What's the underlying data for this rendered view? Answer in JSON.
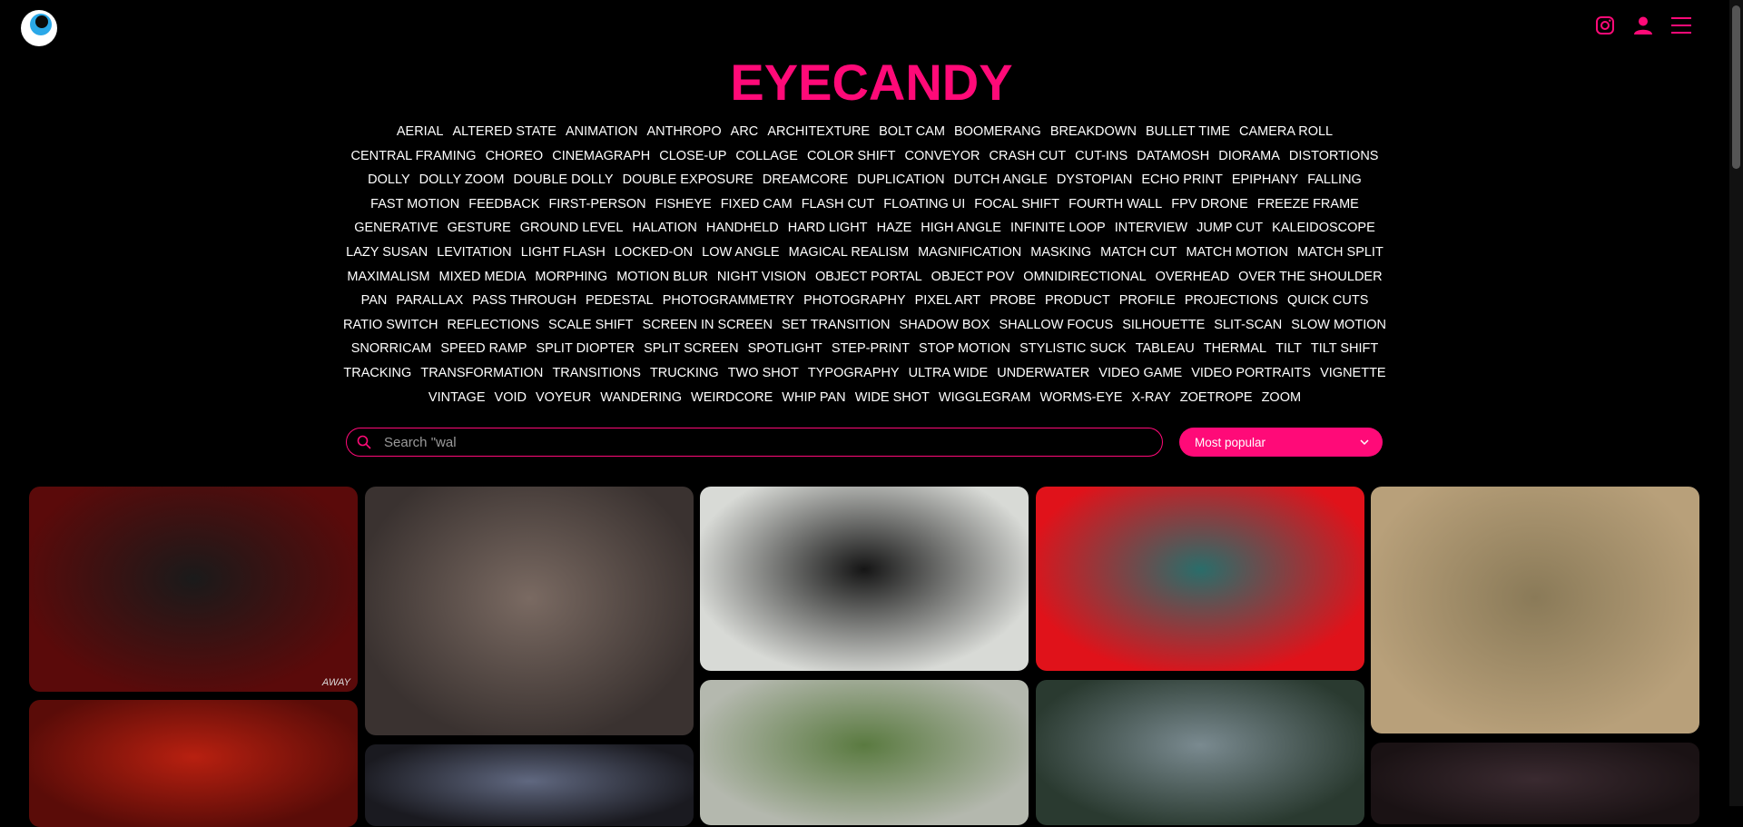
{
  "brand": {
    "title": "EYECANDY",
    "accent": "#ff0a78"
  },
  "header": {
    "logo_icon": "eye-logo-icon",
    "icons": [
      "instagram-icon",
      "user-icon",
      "hamburger-menu-icon"
    ]
  },
  "tags": [
    "AERIAL",
    "ALTERED STATE",
    "ANIMATION",
    "ANTHROPO",
    "ARC",
    "ARCHITEXTURE",
    "BOLT CAM",
    "BOOMERANG",
    "BREAKDOWN",
    "BULLET TIME",
    "CAMERA ROLL",
    "CENTRAL FRAMING",
    "CHOREO",
    "CINEMAGRAPH",
    "CLOSE-UP",
    "COLLAGE",
    "COLOR SHIFT",
    "CONVEYOR",
    "CRASH CUT",
    "CUT-INS",
    "DATAMOSH",
    "DIORAMA",
    "DISTORTIONS",
    "DOLLY",
    "DOLLY ZOOM",
    "DOUBLE DOLLY",
    "DOUBLE EXPOSURE",
    "DREAMCORE",
    "DUPLICATION",
    "DUTCH ANGLE",
    "DYSTOPIAN",
    "ECHO PRINT",
    "EPIPHANY",
    "FALLING",
    "FAST MOTION",
    "FEEDBACK",
    "FIRST-PERSON",
    "FISHEYE",
    "FIXED CAM",
    "FLASH CUT",
    "FLOATING UI",
    "FOCAL SHIFT",
    "FOURTH WALL",
    "FPV DRONE",
    "FREEZE FRAME",
    "GENERATIVE",
    "GESTURE",
    "GROUND LEVEL",
    "HALATION",
    "HANDHELD",
    "HARD LIGHT",
    "HAZE",
    "HIGH ANGLE",
    "INFINITE LOOP",
    "INTERVIEW",
    "JUMP CUT",
    "KALEIDOSCOPE",
    "LAZY SUSAN",
    "LEVITATION",
    "LIGHT FLASH",
    "LOCKED-ON",
    "LOW ANGLE",
    "MAGICAL REALISM",
    "MAGNIFICATION",
    "MASKING",
    "MATCH CUT",
    "MATCH MOTION",
    "MATCH SPLIT",
    "MAXIMALISM",
    "MIXED MEDIA",
    "MORPHING",
    "MOTION BLUR",
    "NIGHT VISION",
    "OBJECT PORTAL",
    "OBJECT POV",
    "OMNIDIRECTIONAL",
    "OVERHEAD",
    "OVER THE SHOULDER",
    "PAN",
    "PARALLAX",
    "PASS THROUGH",
    "PEDESTAL",
    "PHOTOGRAMMETRY",
    "PHOTOGRAPHY",
    "PIXEL ART",
    "PROBE",
    "PRODUCT",
    "PROFILE",
    "PROJECTIONS",
    "QUICK CUTS",
    "RATIO SWITCH",
    "REFLECTIONS",
    "SCALE SHIFT",
    "SCREEN IN SCREEN",
    "SET TRANSITION",
    "SHADOW BOX",
    "SHALLOW FOCUS",
    "SILHOUETTE",
    "SLIT-SCAN",
    "SLOW MOTION",
    "SNORRICAM",
    "SPEED RAMP",
    "SPLIT DIOPTER",
    "SPLIT SCREEN",
    "SPOTLIGHT",
    "STEP-PRINT",
    "STOP MOTION",
    "STYLISTIC SUCK",
    "TABLEAU",
    "THERMAL",
    "TILT",
    "TILT SHIFT",
    "TRACKING",
    "TRANSFORMATION",
    "TRANSITIONS",
    "TRUCKING",
    "TWO SHOT",
    "TYPOGRAPHY",
    "ULTRA WIDE",
    "UNDERWATER",
    "VIDEO GAME",
    "VIDEO PORTRAITS",
    "VIGNETTE",
    "VINTAGE",
    "VOID",
    "VOYEUR",
    "WANDERING",
    "WEIRDCORE",
    "WHIP PAN",
    "WIDE SHOT",
    "WIGGLEGRAM",
    "WORMS-EYE",
    "X-RAY",
    "ZOETROPE",
    "ZOOM"
  ],
  "search": {
    "placeholder": "Search \"wal",
    "icon": "search-icon"
  },
  "sort": {
    "selected": "Most popular",
    "icon": "chevron-down-icon"
  },
  "tiles": [
    {
      "name": "video-thumbnail",
      "stamp": "AWAY",
      "colors": [
        "#5a0a0a",
        "#1a1a1a"
      ]
    },
    {
      "name": "video-thumbnail",
      "stamp": "",
      "colors": [
        "#3a3230",
        "#7a6a62"
      ]
    },
    {
      "name": "video-thumbnail",
      "stamp": "",
      "colors": [
        "#d8dad6",
        "#151515"
      ]
    },
    {
      "name": "video-thumbnail",
      "stamp": "",
      "colors": [
        "#e0121a",
        "#2a6d6a"
      ]
    },
    {
      "name": "video-thumbnail",
      "stamp": "",
      "colors": [
        "#b8a07a",
        "#8a7a58"
      ]
    },
    {
      "name": "video-thumbnail",
      "stamp": "",
      "colors": [
        "#5a0c08",
        "#b82010"
      ]
    },
    {
      "name": "video-thumbnail",
      "stamp": "",
      "colors": [
        "#1a1a20",
        "#606880"
      ]
    },
    {
      "name": "video-thumbnail",
      "stamp": "",
      "colors": [
        "#b4b8ae",
        "#5a7a40"
      ]
    },
    {
      "name": "video-thumbnail",
      "stamp": "",
      "colors": [
        "#2a3a30",
        "#7a8a90"
      ]
    },
    {
      "name": "video-thumbnail",
      "stamp": "",
      "colors": [
        "#1a1214",
        "#3a2a30"
      ]
    }
  ]
}
